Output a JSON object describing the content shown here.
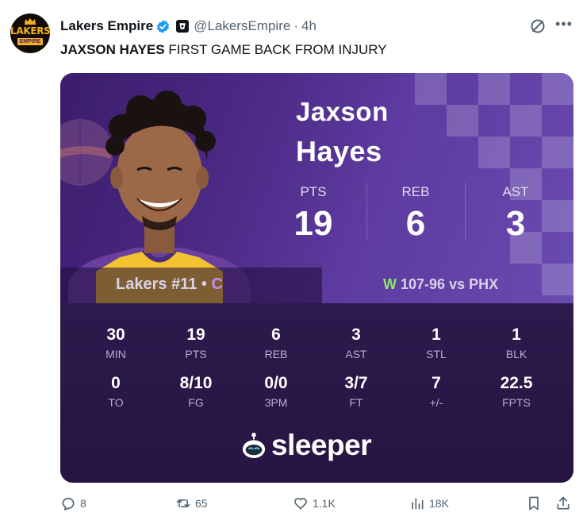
{
  "tweet": {
    "author_name": "Lakers Empire",
    "handle": "@LakersEmpire",
    "separator": "·",
    "time": "4h",
    "text_bold": "JAXSON HAYES",
    "text_rest": " FIRST GAME BACK FROM INJURY",
    "avatar_text": "LAKERS",
    "avatar_subtext": "EMPIRE"
  },
  "card": {
    "first_name": "Jaxson",
    "last_name": "Hayes",
    "big_stats": [
      {
        "label": "PTS",
        "value": "19"
      },
      {
        "label": "REB",
        "value": "6"
      },
      {
        "label": "AST",
        "value": "3"
      }
    ],
    "team_line": "Lakers #11 •",
    "position": "C",
    "result_letter": "W",
    "result_text": "107-96 vs PHX",
    "game_stats_row1": [
      {
        "value": "30",
        "label": "MIN"
      },
      {
        "value": "19",
        "label": "PTS"
      },
      {
        "value": "6",
        "label": "REB"
      },
      {
        "value": "3",
        "label": "AST"
      },
      {
        "value": "1",
        "label": "STL"
      },
      {
        "value": "1",
        "label": "BLK"
      }
    ],
    "game_stats_row2": [
      {
        "value": "0",
        "label": "TO"
      },
      {
        "value": "8/10",
        "label": "FG"
      },
      {
        "value": "0/0",
        "label": "3PM"
      },
      {
        "value": "3/7",
        "label": "FT"
      },
      {
        "value": "7",
        "label": "+/-"
      },
      {
        "value": "22.5",
        "label": "FPTS"
      }
    ],
    "brand": "sleeper"
  },
  "actions": {
    "replies": "8",
    "reposts": "65",
    "likes": "1.1K",
    "views": "18K"
  },
  "colors": {
    "verified_blue": "#1d9bf0",
    "win_green": "#8ee86a",
    "position_purple": "#c98bf5",
    "lakers_gold": "#f5b020"
  }
}
